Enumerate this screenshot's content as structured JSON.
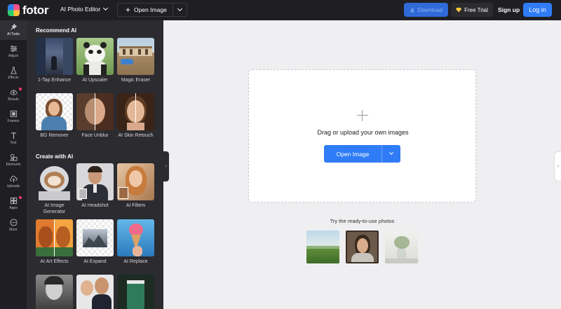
{
  "app": {
    "logo_text": "fotor",
    "editor_label": "AI Photo Editor"
  },
  "toolbar": {
    "open_image_label": "Open Image",
    "download_label": "Download",
    "free_trial_label": "Free Trial",
    "signup_label": "Sign up",
    "login_label": "Log in"
  },
  "rail": [
    {
      "label": "AI Tools",
      "icon": "ai-tools-icon",
      "active": true
    },
    {
      "label": "Adjust",
      "icon": "sliders-icon"
    },
    {
      "label": "Effects",
      "icon": "flask-icon"
    },
    {
      "label": "Beauty",
      "icon": "eye-icon",
      "badge": true
    },
    {
      "label": "Frames",
      "icon": "frame-icon"
    },
    {
      "label": "Text",
      "icon": "text-icon"
    },
    {
      "label": "Elements",
      "icon": "shapes-icon"
    },
    {
      "label": "Uploads",
      "icon": "cloud-upload-icon"
    },
    {
      "label": "Apps",
      "icon": "apps-icon",
      "badge": true
    },
    {
      "label": "More",
      "icon": "more-icon"
    }
  ],
  "panel": {
    "recommend_title": "Recommend AI",
    "create_title": "Create with AI",
    "recommend_tools": [
      {
        "label": "1-Tap Enhance"
      },
      {
        "label": "AI Upscaler"
      },
      {
        "label": "Magic Eraser"
      },
      {
        "label": "BG Remover"
      },
      {
        "label": "Face Unblur"
      },
      {
        "label": "AI Skin Retouch"
      }
    ],
    "create_tools": [
      {
        "label": "AI Image Generator"
      },
      {
        "label": "AI Headshot"
      },
      {
        "label": "AI Filters"
      },
      {
        "label": "AI Art Effects"
      },
      {
        "label": "AI Expand"
      },
      {
        "label": "AI Replace"
      },
      {
        "label": ""
      },
      {
        "label": ""
      },
      {
        "label": ""
      }
    ]
  },
  "main": {
    "upload_message": "Drag or upload your own images",
    "open_button_label": "Open Image",
    "try_label": "Try the ready-to-use photos",
    "samples": [
      "landscape-photo",
      "portrait-photo",
      "vase-photo"
    ]
  },
  "colors": {
    "accent": "#2f7cf6",
    "topbar": "#1f1f23",
    "panel": "#2b2b30"
  }
}
